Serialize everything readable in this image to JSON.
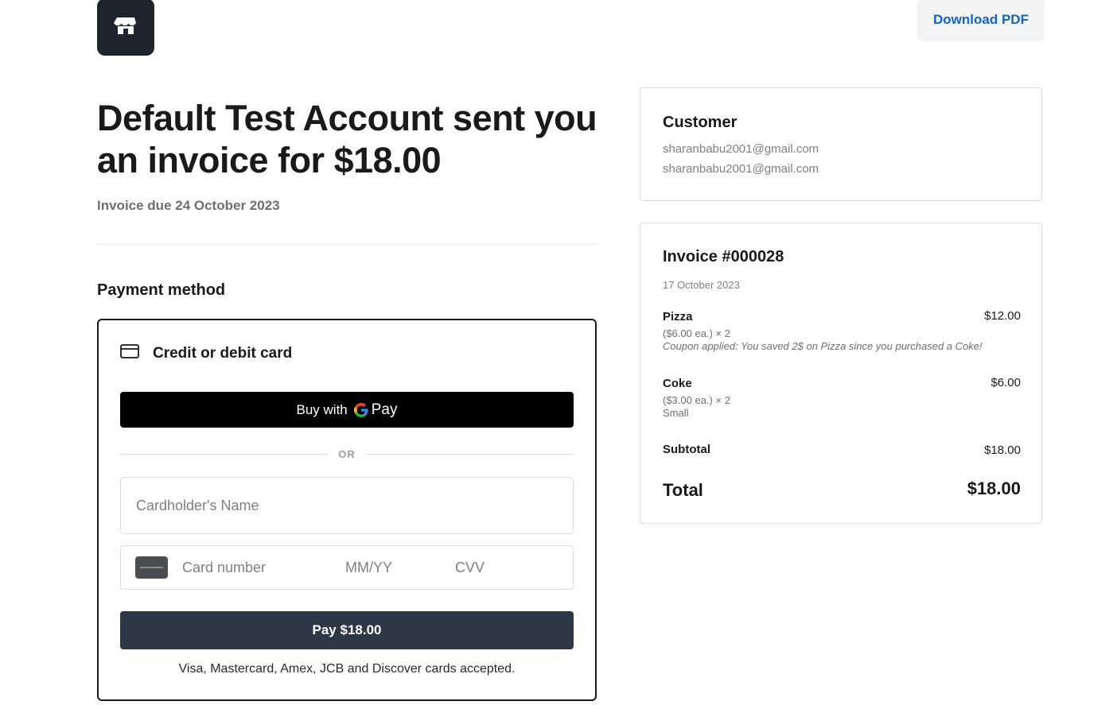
{
  "header": {
    "logo_icon": "storefront-icon",
    "download_label": "Download PDF"
  },
  "invoice_intro": {
    "headline": "Default Test Account sent you an invoice for $18.00",
    "due_date": "Invoice due 24 October 2023"
  },
  "payment": {
    "heading": "Payment method",
    "option_label": "Credit or debit card",
    "option_icon": "credit-card-icon",
    "gpay": {
      "prefix": "Buy with",
      "suffix": "Pay"
    },
    "or_label": "OR",
    "cardholder_placeholder": "Cardholder's Name",
    "card_number_placeholder": "Card number",
    "expiry_placeholder": "MM/YY",
    "cvv_placeholder": "CVV",
    "pay_label": "Pay $18.00",
    "accepted_note": "Visa, Mastercard, Amex, JCB and Discover cards accepted."
  },
  "customer": {
    "title": "Customer",
    "lines": [
      "sharanbabu2001@gmail.com",
      "sharanbabu2001@gmail.com"
    ]
  },
  "invoice": {
    "title": "Invoice #000028",
    "date": "17 October 2023",
    "items": [
      {
        "name": "Pizza",
        "price": "$12.00",
        "detail": "($6.00 ea.) × 2",
        "note": "Coupon applied: You saved 2$ on Pizza since you purchased a Coke!"
      },
      {
        "name": "Coke",
        "price": "$6.00",
        "detail": "($3.00 ea.) × 2",
        "variant": "Small"
      }
    ],
    "subtotal_label": "Subtotal",
    "subtotal_value": "$18.00",
    "total_label": "Total",
    "total_value": "$18.00"
  },
  "colors": {
    "brand_dark": "#1e2530",
    "pay_button": "#2d3846",
    "link_blue": "#1565c0"
  }
}
